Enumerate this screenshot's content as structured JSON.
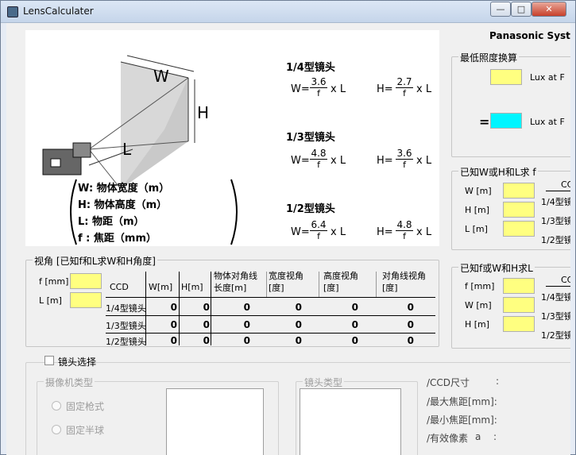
{
  "window": {
    "title": "LensCalculater",
    "min_label": "—",
    "max_label": "□",
    "close_label": "✕"
  },
  "brand": "Panasonic Syste",
  "diagram": {
    "label_w": "W",
    "label_h": "H",
    "label_l": "L",
    "legend": [
      "W:  物体宽度（m）",
      "H:  物体高度（m）",
      "L:  物距（m）",
      "f :  焦距（mm）"
    ],
    "lens_types": [
      {
        "title": "1/4型镜头",
        "w_num": "3.6",
        "h_num": "2.7"
      },
      {
        "title": "1/3型镜头",
        "w_num": "4.8",
        "h_num": "3.6"
      },
      {
        "title": "1/2型镜头",
        "w_num": "6.4",
        "h_num": "4.8"
      }
    ],
    "w_prefix": "W=",
    "h_prefix": "H=",
    "den": "f",
    "suffix": "x L"
  },
  "min_illum": {
    "title": "最低照度换算",
    "lux1": "Lux at F",
    "equals": "=",
    "lux2": "Lux at F"
  },
  "known_wh": {
    "title": "已知W或H和L求 f",
    "ccd": "CCD",
    "w": "W [m]",
    "h": "H [m]",
    "l": "L [m]",
    "r1": "1/4型镜",
    "r2": "1/3型镜",
    "r3": "1/2型镜"
  },
  "known_fw": {
    "title": "已知f或W和H求L",
    "ccd": "CCD",
    "f": "f [mm]",
    "w": "W [m]",
    "h": "H [m]",
    "r1": "1/4型镜",
    "r2": "1/3型镜",
    "r3": "1/2型镜"
  },
  "view_angle": {
    "title": "视角 [已知f和L求W和H角度]",
    "f_label": "f [mm]",
    "l_label": "L [m]",
    "headers": [
      "CCD",
      "W[m]",
      "H[m]",
      "物体对角线长度[m]",
      "宽度视角[度]",
      "高度视角[度]",
      "对角线视角[度]"
    ],
    "rows": [
      {
        "ccd": "1/4型镜头",
        "values": [
          "0",
          "0",
          "0",
          "0",
          "0",
          "0"
        ]
      },
      {
        "ccd": "1/3型镜头",
        "values": [
          "0",
          "0",
          "0",
          "0",
          "0",
          "0"
        ]
      },
      {
        "ccd": "1/2型镜头",
        "values": [
          "0",
          "0",
          "0",
          "0",
          "0",
          "0"
        ]
      }
    ]
  },
  "lens_select": {
    "checkbox_label": "镜头选择",
    "camera_group": "摄像机类型",
    "radio1": "固定枪式",
    "radio2": "固定半球",
    "lens_group": "镜头类型",
    "ccd_size": "/CCD尺寸",
    "ccd_colon": ":",
    "max_focal": "/最大焦距[mm]:",
    "min_focal": "/最小焦距[mm]:",
    "pixels": "/有效像素",
    "pixels_a": "a",
    "pixels_colon": ":"
  }
}
